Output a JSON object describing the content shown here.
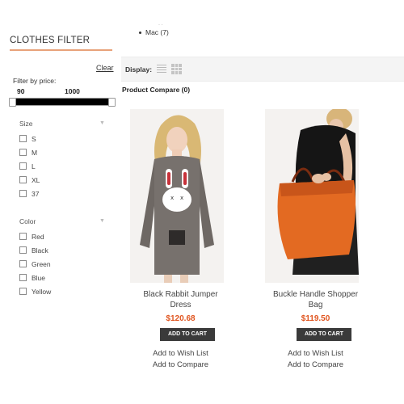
{
  "categories": {
    "items": [
      {
        "label": "Mac (7)"
      }
    ]
  },
  "sidebar": {
    "title": "CLOTHES FILTER",
    "clear": "Clear",
    "price": {
      "label": "Filter by price:",
      "min": "90",
      "max": "1000"
    },
    "size": {
      "label": "Size",
      "options": [
        "S",
        "M",
        "L",
        "XL",
        "37"
      ]
    },
    "color": {
      "label": "Color",
      "options": [
        "Red",
        "Black",
        "Green",
        "Blue",
        "Yellow"
      ]
    }
  },
  "toolbar": {
    "display_label": "Display:"
  },
  "compare": {
    "title": "Product Compare (0)"
  },
  "products": [
    {
      "name_line1": "Black Rabbit Jumper",
      "name_line2": "Dress",
      "price": "$120.68",
      "cart": "ADD TO CART",
      "wishlist": "Add to Wish List",
      "compare": "Add to Compare"
    },
    {
      "name_line1": "Buckle Handle Shopper",
      "name_line2": "Bag",
      "price": "$119.50",
      "cart": "ADD TO CART",
      "wishlist": "Add to Wish List",
      "compare": "Add to Compare"
    }
  ],
  "colors": {
    "accent_rule": "#e8a27a",
    "price": "#e0541e",
    "button": "#3a3a3a",
    "toolbar_bg": "#f4f4f4"
  },
  "icons": [
    "list-view-icon",
    "grid-view-icon",
    "caret-down-icon",
    "checkbox-icon"
  ]
}
